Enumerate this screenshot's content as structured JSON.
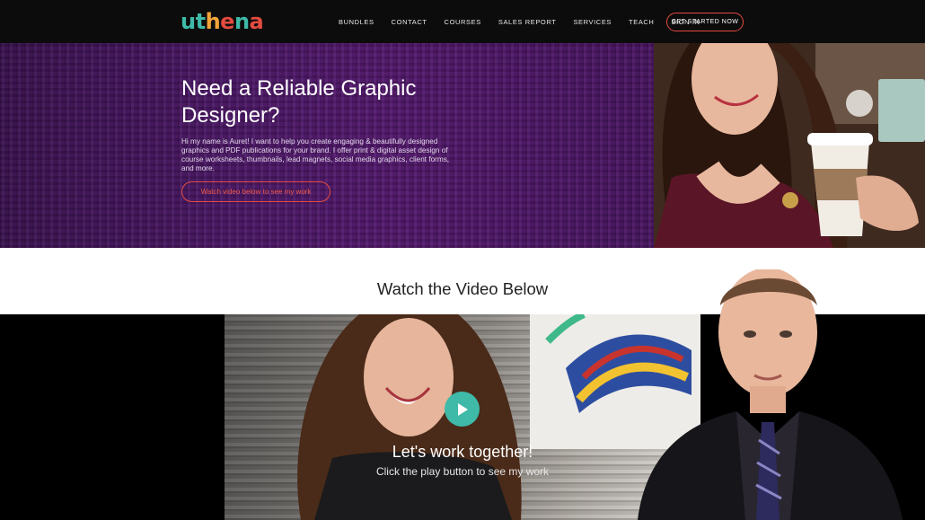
{
  "brand": {
    "logo_letters": [
      {
        "ch": "u",
        "color": "#3fb9a8"
      },
      {
        "ch": "t",
        "color": "#3fb9a8"
      },
      {
        "ch": "h",
        "color": "#f2a33a"
      },
      {
        "ch": "e",
        "color": "#e44b40"
      },
      {
        "ch": "n",
        "color": "#3fb9a8"
      },
      {
        "ch": "a",
        "color": "#e44b40"
      }
    ],
    "accent": "#e44b40",
    "teal": "#3fb9a8"
  },
  "nav": {
    "items": [
      "BUNDLES",
      "CONTACT",
      "COURSES",
      "SALES REPORT",
      "SERVICES",
      "TEACH",
      "SIGN IN"
    ],
    "cta": "GET STARTED NOW"
  },
  "hero": {
    "title": "Need a Reliable Graphic Designer?",
    "description": "Hi my name is Auret! I want to help you create engaging & beautifully designed graphics and PDF publications for your brand. I offer print & digital asset design of course worksheets, thumbnails, lead magnets, social media graphics, client forms, and more.",
    "button": "Watch video below to see my work",
    "background": "#4d1868"
  },
  "section": {
    "heading": "Watch the Video Below"
  },
  "video": {
    "title": "Let's work together!",
    "subtitle": "Click the play button to see my work",
    "play_icon": "play-icon"
  }
}
